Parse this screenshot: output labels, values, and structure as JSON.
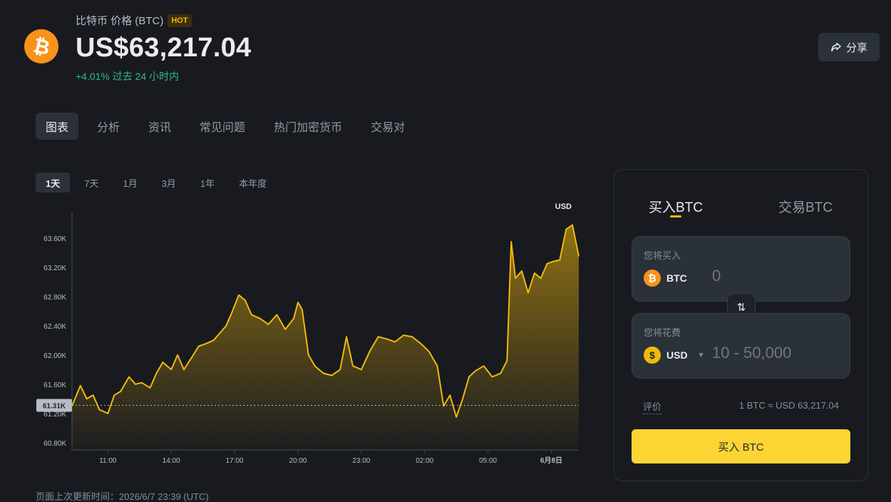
{
  "coin": {
    "name": "比特币 价格 (BTC)",
    "badge": "HOT",
    "price": "US$63,217.04",
    "change": "+4.01% 过去 24 小时内",
    "logo_glyph": "₿",
    "logo_color": "#f7931a"
  },
  "share": {
    "label": "分享",
    "icon": "share-icon"
  },
  "main_tabs": [
    "图表",
    "分析",
    "资讯",
    "常见问题",
    "热门加密货币",
    "交易对"
  ],
  "range_tabs": [
    "1天",
    "7天",
    "1月",
    "3月",
    "1年",
    "本年度"
  ],
  "updated": "页面上次更新时间：2026/6/7 23:39 (UTC)",
  "trade": {
    "tabs": [
      "买入BTC",
      "交易BTC"
    ],
    "buy_label": "您将买入",
    "buy_coin": "BTC",
    "buy_placeholder": "0",
    "spend_label": "您将花费",
    "spend_coin": "USD",
    "spend_placeholder": "10 - 50,000",
    "swap_icon": "⇅",
    "rate_label": "评价",
    "rate_value": "1 BTC ≈ USD 63,217.04",
    "buy_button": "买入 BTC"
  },
  "colors": {
    "accent": "#f0b90b",
    "positive": "#2ebd85",
    "button": "#fcd535"
  },
  "chart_data": {
    "type": "area",
    "currency_label": "USD",
    "y_ticks": [
      "63.60K",
      "63.20K",
      "62.80K",
      "62.40K",
      "62.00K",
      "61.60K",
      "61.20K",
      "60.80K"
    ],
    "ylim": [
      60.7,
      63.95
    ],
    "x_ticks": [
      "11:00",
      "14:00",
      "17:00",
      "20:00",
      "23:00",
      "02:00",
      "05:00",
      "6月8日"
    ],
    "x_tick_hours": [
      11,
      14,
      17,
      20,
      23,
      26,
      29,
      32
    ],
    "xlim": [
      9.3,
      33.3
    ],
    "baseline_value": 61.31,
    "baseline_label": "61.31K",
    "line_color": "#f0b90b",
    "series": [
      {
        "x": [
          9.3,
          9.7,
          10.0,
          10.3,
          10.6,
          11.0,
          11.3,
          11.6,
          12.0,
          12.3,
          12.6,
          13.0,
          13.3,
          13.6,
          14.0,
          14.3,
          14.6,
          15.0,
          15.3,
          15.6,
          16.0,
          16.3,
          16.6,
          16.9,
          17.2,
          17.5,
          17.8,
          18.2,
          18.6,
          19.0,
          19.4,
          19.8,
          20.0,
          20.2,
          20.5,
          20.8,
          21.2,
          21.6,
          22.0,
          22.3,
          22.6,
          23.0,
          23.4,
          23.8,
          24.2,
          24.6,
          25.0,
          25.4,
          25.8,
          26.2,
          26.6,
          26.9,
          27.2,
          27.5,
          27.8,
          28.1,
          28.4,
          28.8,
          29.2,
          29.6,
          29.9,
          30.1,
          30.3,
          30.6,
          30.9,
          31.2,
          31.5,
          31.8,
          32.1,
          32.4,
          32.7,
          33.0,
          33.3
        ],
        "values": [
          61.3,
          61.58,
          61.4,
          61.45,
          61.25,
          61.2,
          61.45,
          61.5,
          61.7,
          61.6,
          61.62,
          61.55,
          61.75,
          61.9,
          61.8,
          62.0,
          61.8,
          61.98,
          62.12,
          62.15,
          62.2,
          62.3,
          62.4,
          62.6,
          62.82,
          62.75,
          62.55,
          62.5,
          62.42,
          62.55,
          62.35,
          62.5,
          62.72,
          62.62,
          62.0,
          61.85,
          61.75,
          61.72,
          61.8,
          62.25,
          61.85,
          61.8,
          62.05,
          62.25,
          62.22,
          62.18,
          62.27,
          62.25,
          62.16,
          62.05,
          61.85,
          61.3,
          61.45,
          61.15,
          61.4,
          61.7,
          61.78,
          61.85,
          61.7,
          61.75,
          61.92,
          63.55,
          63.05,
          63.15,
          62.85,
          63.12,
          63.05,
          63.25,
          63.28,
          63.3,
          63.72,
          63.78,
          63.35
        ]
      }
    ]
  }
}
